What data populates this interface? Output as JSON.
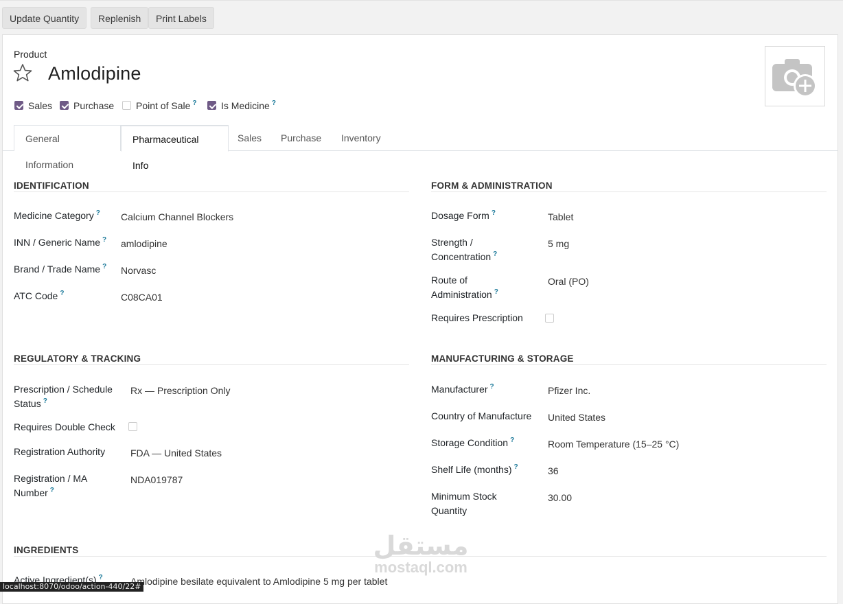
{
  "toolbar": {
    "update_quantity": "Update Quantity",
    "replenish": "Replenish",
    "print_labels": "Print Labels"
  },
  "header": {
    "product_label": "Product",
    "product_name": "Amlodipine"
  },
  "flags": {
    "sales": {
      "label": "Sales",
      "checked": true
    },
    "purchase": {
      "label": "Purchase",
      "checked": true
    },
    "pos": {
      "label": "Point of Sale",
      "checked": false
    },
    "medicine": {
      "label": "Is Medicine",
      "checked": true
    }
  },
  "help_mark": "?",
  "tabs": [
    "General Information",
    "Pharmaceutical Info",
    "Sales",
    "Purchase",
    "Inventory"
  ],
  "identification": {
    "title": "IDENTIFICATION",
    "medicine_category_label": "Medicine Category",
    "medicine_category": "Calcium Channel Blockers",
    "inn_label": "INN / Generic Name",
    "inn": "amlodipine",
    "brand_label": "Brand / Trade Name",
    "brand": "Norvasc",
    "atc_label": "ATC Code",
    "atc": "C08CA01"
  },
  "form": {
    "title": "FORM & ADMINISTRATION",
    "dosage_form_label": "Dosage Form",
    "dosage_form": "Tablet",
    "strength_label_1": "Strength /",
    "strength_label_2": "Concentration",
    "strength": "5 mg",
    "route_label_1": "Route of",
    "route_label_2": "Administration",
    "route": "Oral (PO)",
    "requires_prescription_label": "Requires Prescription",
    "requires_prescription": false
  },
  "regulatory": {
    "title": "REGULATORY & TRACKING",
    "status_label_1": "Prescription / Schedule",
    "status_label_2": "Status",
    "status": "Rx — Prescription Only",
    "double_check_label": "Requires Double Check",
    "double_check": false,
    "authority_label": "Registration Authority",
    "authority": "FDA — United States",
    "ma_label_1": "Registration / MA",
    "ma_label_2": "Number",
    "ma": "NDA019787"
  },
  "manufacturing": {
    "title": "MANUFACTURING & STORAGE",
    "manufacturer_label": "Manufacturer",
    "manufacturer": "Pfizer Inc.",
    "country_label": "Country of Manufacture",
    "country": "United States",
    "storage_label": "Storage Condition",
    "storage": "Room Temperature (15–25 °C)",
    "shelf_label": "Shelf Life (months)",
    "shelf": "36",
    "min_stock_label_1": "Minimum Stock",
    "min_stock_label_2": "Quantity",
    "min_stock": "30.00"
  },
  "ingredients": {
    "title": "INGREDIENTS",
    "active_label": "Active Ingredient(s)",
    "active": "Amlodipine besilate equivalent to Amlodipine 5 mg per tablet"
  },
  "status_url": "localhost:8070/odoo/action-440/22#",
  "watermark": {
    "arabic": "مستقل",
    "latin": "mostaql.com"
  },
  "colors": {
    "checkbox": "#6f5a86",
    "help": "#1c7a9a"
  }
}
